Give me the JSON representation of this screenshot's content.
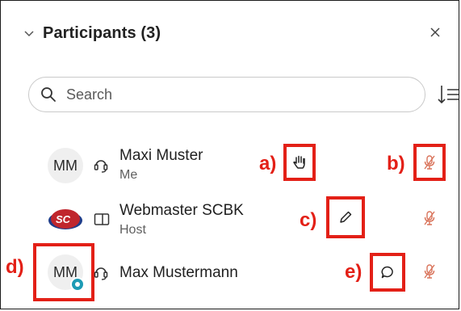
{
  "panel": {
    "title": "Participants (3)"
  },
  "search": {
    "placeholder": "Search"
  },
  "participants": [
    {
      "initials": "MM",
      "name": "Maxi Muster",
      "role": "Me",
      "audio": "headset-icon",
      "action": "raise-hand-icon",
      "mic": "mic-muted-icon"
    },
    {
      "initials": "SC",
      "name": "Webmaster SCBK",
      "role": "Host",
      "audio": "screen-icon",
      "action": "pencil-icon",
      "mic": "mic-muted-icon"
    },
    {
      "initials": "MM",
      "name": "Max Mustermann",
      "role": "",
      "audio": "headset-icon",
      "action": "chat-bubble-icon",
      "mic": "mic-muted-icon"
    }
  ],
  "annotations": {
    "a": "a)",
    "b": "b)",
    "c": "c)",
    "d": "d)",
    "e": "e)"
  },
  "colors": {
    "annotation": "#e32017",
    "muted_mic": "#d9735a",
    "logo_red": "#c0262d",
    "logo_blue": "#1f3d8a"
  }
}
